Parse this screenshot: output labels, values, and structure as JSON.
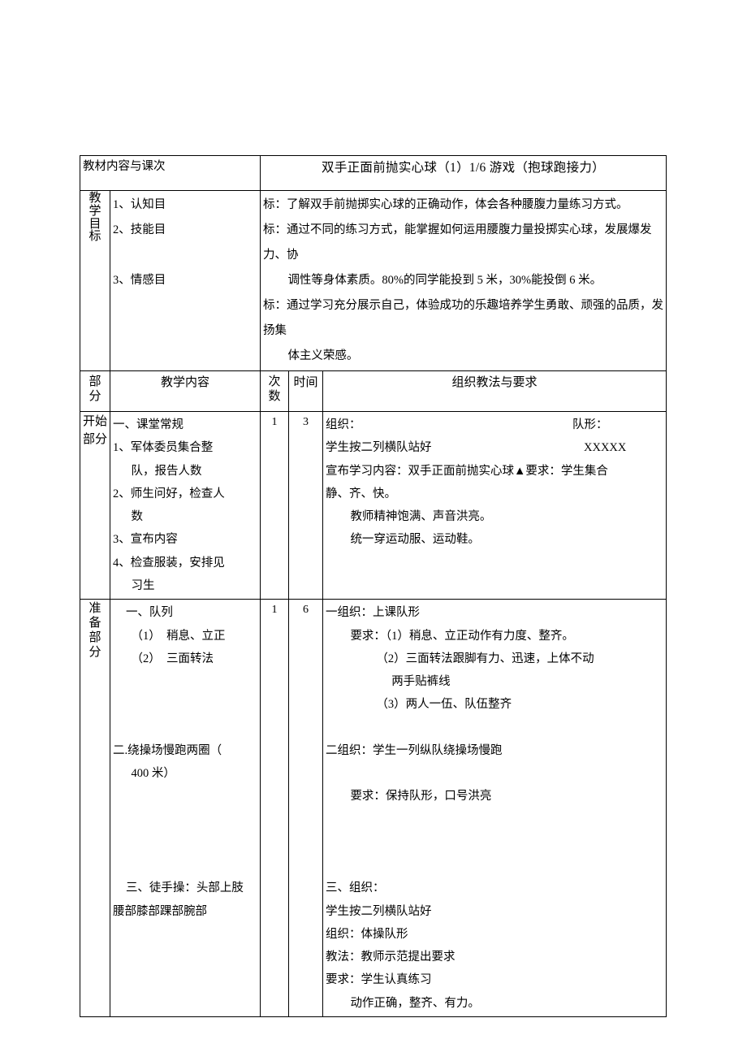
{
  "document": {
    "title_row": {
      "material_label": "教材内容与课次",
      "lesson_title": "双手正面前抛实心球（1）1/6 游戏（抱球跑接力）"
    },
    "objectives": {
      "label_chars": [
        "教",
        "学",
        "目",
        "标"
      ],
      "items": [
        {
          "name": "1、认知目",
          "text": "标：了解双手前抛掷实心球的正确动作，体会各种腰腹力量练习方式。",
          "cont": ""
        },
        {
          "name": "2、技能目",
          "text": "标：通过不同的练习方式，能掌握如何运用腰腹力量投掷实心球，发展爆发力、协",
          "cont": "调性等身体素质。80%的同学能投到 5 米，30%能投倒 6 米。"
        },
        {
          "name": "3、情感目",
          "text": "标：通过学习充分展示自己，体验成功的乐趣培养学生勇敢、顽强的品质，发扬集",
          "cont": "体主义荣感。"
        }
      ]
    },
    "columns": {
      "part": [
        "部",
        "分"
      ],
      "content": "教学内容",
      "times": [
        "次",
        "数"
      ],
      "time": "时间",
      "method": "组织教法与要求"
    },
    "rows": [
      {
        "section": [
          "开始",
          "部分"
        ],
        "content_lines": [
          {
            "text": "一、课堂常规",
            "indent": 0
          },
          {
            "text": "1、军体委员集合整",
            "indent": 0
          },
          {
            "text": "队，报告人数",
            "indent": 1
          },
          {
            "text": "2、师生问好，检查人",
            "indent": 0
          },
          {
            "text": "数",
            "indent": 1
          },
          {
            "text": "3、宣布内容",
            "indent": 0
          },
          {
            "text": "4、检查服装，安排见",
            "indent": 0
          },
          {
            "text": "习生",
            "indent": 1
          }
        ],
        "times": "1",
        "time": "3",
        "method_lines": [
          {
            "text": "组织：",
            "indent": 0,
            "form_label": "队形："
          },
          {
            "text": "学生按二列横队站好",
            "indent": 0,
            "form_value": "XXXXX"
          },
          {
            "text": "宣布学习内容：双手正面前抛实心球▲要求：学生集合",
            "indent": 0
          },
          {
            "text": "静、齐、快。",
            "indent": 0
          },
          {
            "text": "教师精神饱满、声音洪亮。",
            "indent": 1
          },
          {
            "text": "统一穿运动服、运动鞋。",
            "indent": 1
          }
        ]
      },
      {
        "section": [
          "准",
          "备",
          "部",
          "分"
        ],
        "content_lines": [
          {
            "text": "一、队列",
            "indent": 0
          },
          {
            "text": "（1）　稍息、立正",
            "indent": 1
          },
          {
            "text": "（2）　三面转法",
            "indent": 1
          },
          {
            "text": "",
            "indent": 0
          },
          {
            "text": "",
            "indent": 0
          },
          {
            "text": "",
            "indent": 0
          },
          {
            "text": "二.绕操场慢跑两圈（",
            "indent": 0
          },
          {
            "text": "400 米）",
            "indent": 1
          },
          {
            "text": "",
            "indent": 0
          },
          {
            "text": "",
            "indent": 0
          },
          {
            "text": "",
            "indent": 0
          },
          {
            "text": "",
            "indent": 0
          },
          {
            "text": "三、徒手操：头部上肢",
            "indent": 1
          },
          {
            "text": "腰部膝部踝部腕部",
            "indent": 0
          }
        ],
        "times": "1",
        "time": "6",
        "method_lines": [
          {
            "text": "一组织：上课队形",
            "indent": 0
          },
          {
            "text": "要求：（1）稍息、立正动作有力度、整齐。",
            "indent": 1
          },
          {
            "text": "（2）三面转法跟脚有力、迅速，上体不动",
            "indent": 2
          },
          {
            "text": "两手贴裤线",
            "indent": 3
          },
          {
            "text": "（3）两人一伍、队伍整齐",
            "indent": 2
          },
          {
            "text": "",
            "indent": 0
          },
          {
            "text": "二组织：学生一列纵队绕操场慢跑",
            "indent": 0
          },
          {
            "text": "",
            "indent": 0
          },
          {
            "text": "要求：保持队形，口号洪亮",
            "indent": 1
          },
          {
            "text": "",
            "indent": 0
          },
          {
            "text": "",
            "indent": 0
          },
          {
            "text": "",
            "indent": 0
          },
          {
            "text": "三、组织：",
            "indent": 0
          },
          {
            "text": "学生按二列横队站好",
            "indent": 0
          },
          {
            "text": "组织：体操队形",
            "indent": 0
          },
          {
            "text": "教法：教师示范提出要求",
            "indent": 0
          },
          {
            "text": "要求：学生认真练习",
            "indent": 0
          },
          {
            "text": "动作正确，整齐、有力。",
            "indent": 1
          }
        ]
      }
    ]
  }
}
